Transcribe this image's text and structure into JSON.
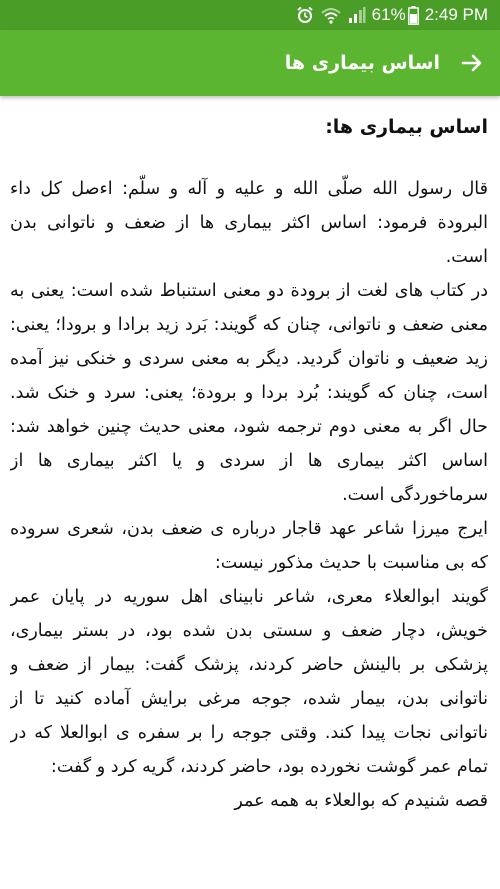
{
  "status_bar": {
    "battery_percent": "61%",
    "time": "2:49 PM",
    "icons": [
      "alarm-icon",
      "wifi-icon",
      "signal-icon",
      "battery-icon"
    ]
  },
  "app_bar": {
    "title": "اساس بیماری ها",
    "back_icon": "arrow-right-icon"
  },
  "article": {
    "heading": "اساس بیماری ها:",
    "paragraphs": [
      "قال رسول الله صلّی الله و علیه و آله و سلّم: اءصل کل داء البرودة فرمود: اساس اکثر بیماری ها از ضعف و ناتوانی بدن است.",
      "در کتاب های لغت از برودة دو معنی استنباط شده است: یعنی به معنی ضعف و ناتوانی، چنان که گویند: بَرد زید برادا و برودا؛ یعنی: زید ضعیف و ناتوان گردید. دیگر به معنی سردی و خنکی نیز آمده است، چنان که گویند: بُرد بردا و برودة؛ یعنی: سرد و خنک شد. حال اگر به معنی دوم ترجمه شود، معنی حدیث چنین خواهد شد: اساس اکثر بیماری ها از سردی و یا اکثر بیماری ها از سرماخوردگی است.",
      "ایرج میرزا شاعر عهد قاجار درباره ی ضعف بدن، شعری سروده که بی مناسبت با حدیث مذکور نیست:",
      "گویند ابوالعلاء معری، شاعر نابینای اهل سوریه در پایان عمر خویش، دچار ضعف و سستی بدن شده بود، در بستر بیماری، پزشکی بر بالینش حاضر کردند، پزشک گفت: بیمار از ضعف و ناتوانی بدن، بیمار شده، جوجه مرغی برایش آماده کنید تا از ناتوانی نجات پیدا کند. وقتی جوجه را بر سفره ی ابوالعلا که در تمام عمر گوشت نخورده بود، حاضر کردند، گریه کرد و گفت:",
      "قصه شنیدم که بوالعلاء به همه عمر"
    ]
  }
}
